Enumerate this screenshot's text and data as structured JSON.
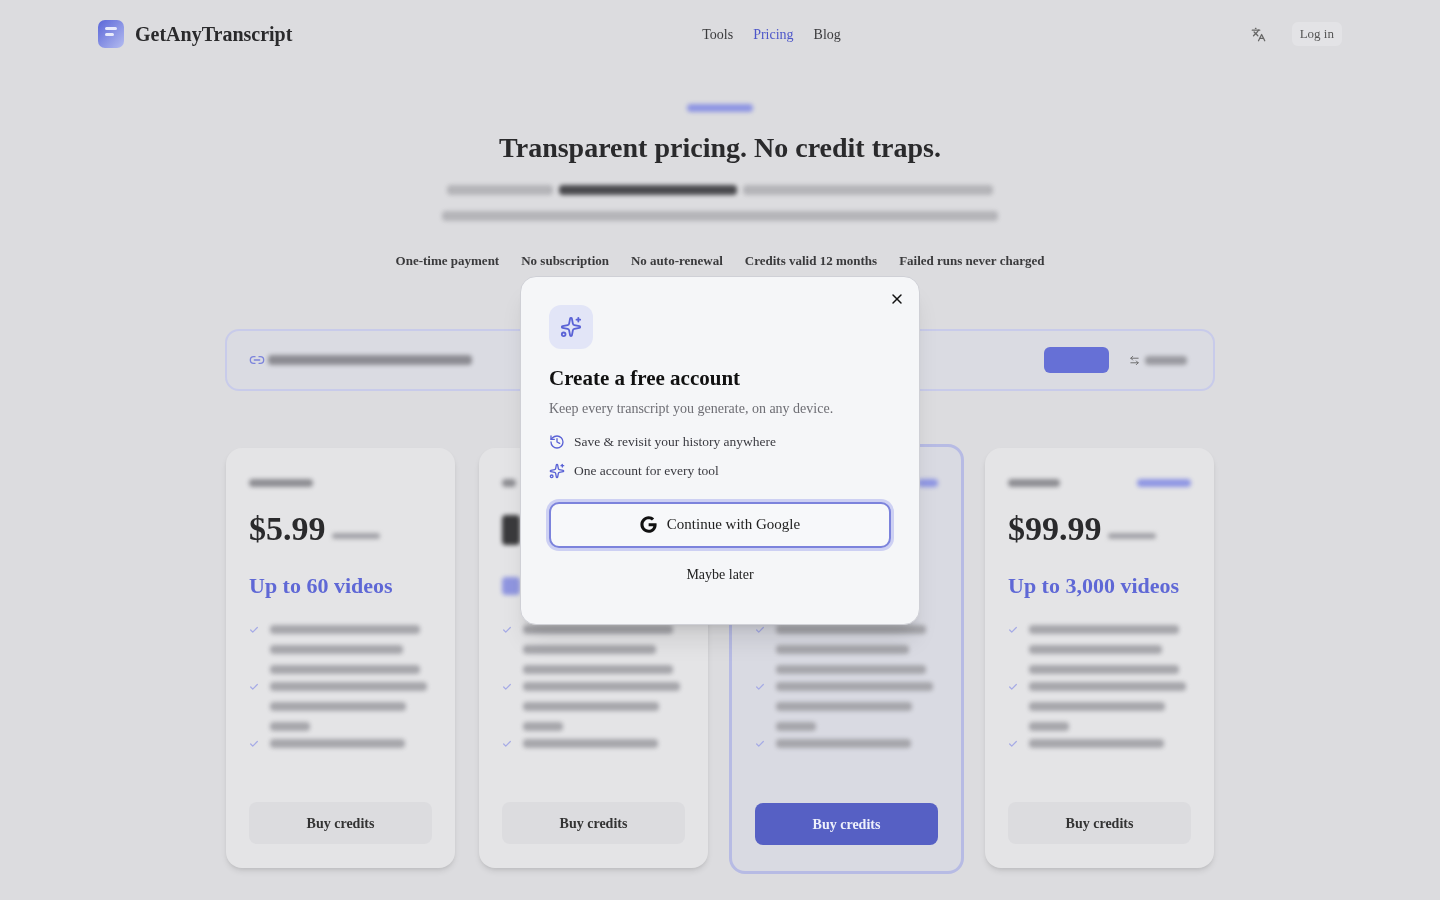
{
  "background_page": {
    "header": {
      "logo_text": "GetAnyTranscript",
      "nav": [
        {
          "label": "Tools",
          "selected": false
        },
        {
          "label": "Pricing",
          "selected": true
        },
        {
          "label": "Blog",
          "selected": false
        }
      ],
      "login_button": "Log in"
    },
    "hero": {
      "title": "Transparent pricing. No credit traps.",
      "features": [
        "One-time payment",
        "No subscription",
        "No auto-renewal",
        "Credits valid 12 months",
        "Failed runs never charged"
      ]
    },
    "plans": [
      {
        "price": "$5.99",
        "videos": "Up to 60 videos",
        "button": "Buy credits",
        "highlighted": false
      },
      {
        "button": "Buy credits",
        "highlighted": false
      },
      {
        "button": "Buy credits",
        "highlighted": true
      },
      {
        "price": "$99.99",
        "videos": "Up to 3,000 videos",
        "button": "Buy credits",
        "highlighted": false
      }
    ]
  },
  "dialog": {
    "title": "Create a free account",
    "description": "Keep every transcript you generate, on any device.",
    "features": [
      {
        "kind": "history",
        "text": "Save & revisit your history anywhere"
      },
      {
        "kind": "sparkles",
        "text": "One account for every tool"
      }
    ],
    "primary_button": "Continue with Google",
    "secondary_button": "Maybe later"
  }
}
